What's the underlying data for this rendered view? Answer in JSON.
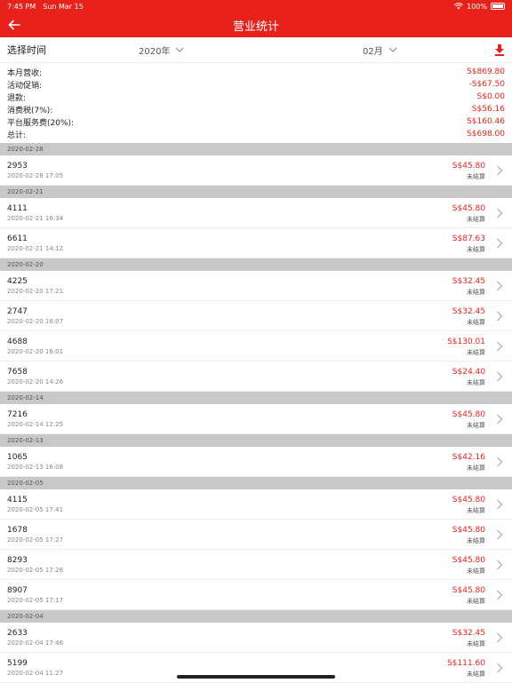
{
  "status": {
    "time": "7:45 PM",
    "date": "Sun Mar 15",
    "battery": "100%"
  },
  "nav": {
    "title": "营业统计"
  },
  "filter": {
    "label": "选择时间",
    "year": "2020年",
    "month": "02月"
  },
  "summary": [
    {
      "label": "本月营收:",
      "value": "S$869.80"
    },
    {
      "label": "活动促销:",
      "value": "-S$67.50"
    },
    {
      "label": "退款:",
      "value": "S$0.00"
    },
    {
      "label": "消费税(7%):",
      "value": "S$56.16"
    },
    {
      "label": "平台服务费(20%):",
      "value": "S$160.46"
    },
    {
      "label": "总计:",
      "value": "S$698.00"
    }
  ],
  "groups": [
    {
      "date": "2020-02-28",
      "items": [
        {
          "num": "2953",
          "time": "2020-02-28 17:05",
          "amount": "S$45.80",
          "status": "未结算"
        }
      ]
    },
    {
      "date": "2020-02-21",
      "items": [
        {
          "num": "4111",
          "time": "2020-02-21 16:34",
          "amount": "S$45.80",
          "status": "未结算"
        },
        {
          "num": "6611",
          "time": "2020-02-21 14:12",
          "amount": "S$87.63",
          "status": "未结算"
        }
      ]
    },
    {
      "date": "2020-02-20",
      "items": [
        {
          "num": "4225",
          "time": "2020-02-20 17:21",
          "amount": "S$32.45",
          "status": "未结算"
        },
        {
          "num": "2747",
          "time": "2020-02-20 16:07",
          "amount": "S$32.45",
          "status": "未结算"
        },
        {
          "num": "4688",
          "time": "2020-02-20 16:01",
          "amount": "S$130.01",
          "status": "未结算"
        },
        {
          "num": "7658",
          "time": "2020-02-20 14:26",
          "amount": "S$24.40",
          "status": "未结算"
        }
      ]
    },
    {
      "date": "2020-02-14",
      "items": [
        {
          "num": "7216",
          "time": "2020-02-14 12:25",
          "amount": "S$45.80",
          "status": "未结算"
        }
      ]
    },
    {
      "date": "2020-02-13",
      "items": [
        {
          "num": "1065",
          "time": "2020-02-13 16:08",
          "amount": "S$42.16",
          "status": "未结算"
        }
      ]
    },
    {
      "date": "2020-02-05",
      "items": [
        {
          "num": "4115",
          "time": "2020-02-05 17:41",
          "amount": "S$45.80",
          "status": "未结算"
        },
        {
          "num": "1678",
          "time": "2020-02-05 17:27",
          "amount": "S$45.80",
          "status": "未结算"
        },
        {
          "num": "8293",
          "time": "2020-02-05 17:26",
          "amount": "S$45.80",
          "status": "未结算"
        },
        {
          "num": "8907",
          "time": "2020-02-05 17:17",
          "amount": "S$45.80",
          "status": "未结算"
        }
      ]
    },
    {
      "date": "2020-02-04",
      "items": [
        {
          "num": "2633",
          "time": "2020-02-04 17:46",
          "amount": "S$32.45",
          "status": "未结算"
        },
        {
          "num": "5199",
          "time": "2020-02-04 11:27",
          "amount": "S$111.60",
          "status": "未结算"
        }
      ]
    }
  ],
  "colors": {
    "accent": "#e8221b",
    "section": "#c8c8c8"
  }
}
